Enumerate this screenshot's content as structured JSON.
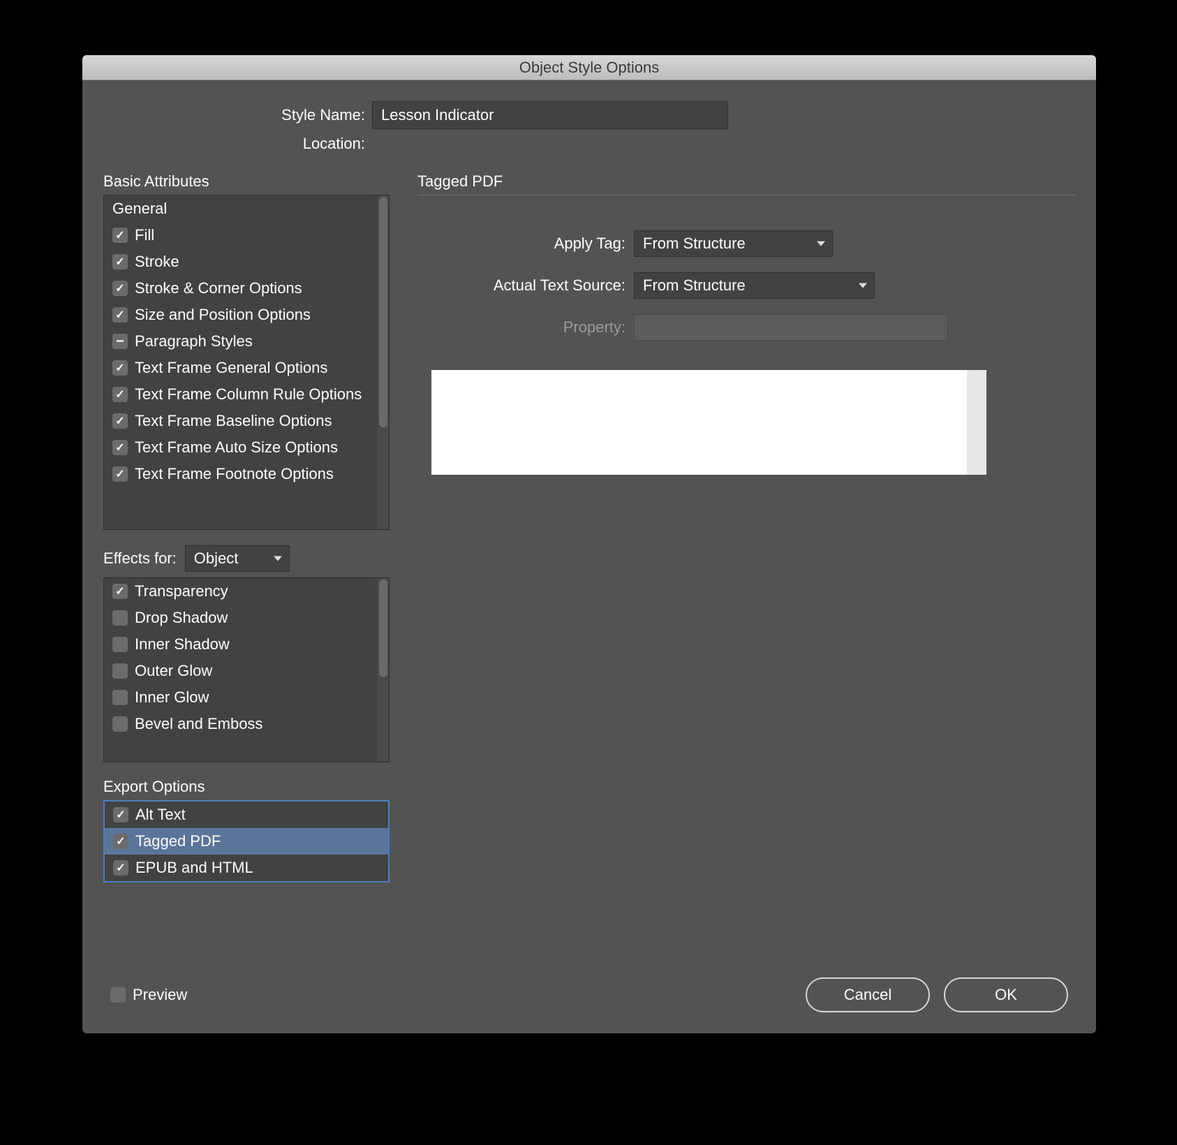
{
  "window": {
    "title": "Object Style Options"
  },
  "fields": {
    "style_name_label": "Style Name:",
    "style_name_value": "Lesson Indicator",
    "location_label": "Location:"
  },
  "sections": {
    "basic_attributes": "Basic Attributes",
    "effects_for": "Effects for:",
    "effects_for_value": "Object",
    "export_options": "Export Options",
    "right_panel_title": "Tagged PDF"
  },
  "basic_items": [
    {
      "label": "General",
      "state": "none"
    },
    {
      "label": "Fill",
      "state": "checked"
    },
    {
      "label": "Stroke",
      "state": "checked"
    },
    {
      "label": "Stroke & Corner Options",
      "state": "checked"
    },
    {
      "label": "Size and Position Options",
      "state": "checked"
    },
    {
      "label": "Paragraph Styles",
      "state": "mixed"
    },
    {
      "label": "Text Frame General Options",
      "state": "checked"
    },
    {
      "label": "Text Frame Column Rule Options",
      "state": "checked"
    },
    {
      "label": "Text Frame Baseline Options",
      "state": "checked"
    },
    {
      "label": "Text Frame Auto Size Options",
      "state": "checked"
    },
    {
      "label": "Text Frame Footnote Options",
      "state": "checked"
    }
  ],
  "effects_items": [
    {
      "label": "Transparency",
      "state": "checked"
    },
    {
      "label": "Drop Shadow",
      "state": "empty"
    },
    {
      "label": "Inner Shadow",
      "state": "empty"
    },
    {
      "label": "Outer Glow",
      "state": "empty"
    },
    {
      "label": "Inner Glow",
      "state": "empty"
    },
    {
      "label": "Bevel and Emboss",
      "state": "empty"
    }
  ],
  "export_items": [
    {
      "label": "Alt Text",
      "state": "checked",
      "selected": false
    },
    {
      "label": "Tagged PDF",
      "state": "checked",
      "selected": true
    },
    {
      "label": "EPUB and HTML",
      "state": "checked",
      "selected": false
    }
  ],
  "right_form": {
    "apply_tag_label": "Apply Tag:",
    "apply_tag_value": "From Structure",
    "actual_text_label": "Actual Text Source:",
    "actual_text_value": "From Structure",
    "property_label": "Property:"
  },
  "footer": {
    "preview_label": "Preview",
    "cancel": "Cancel",
    "ok": "OK"
  }
}
